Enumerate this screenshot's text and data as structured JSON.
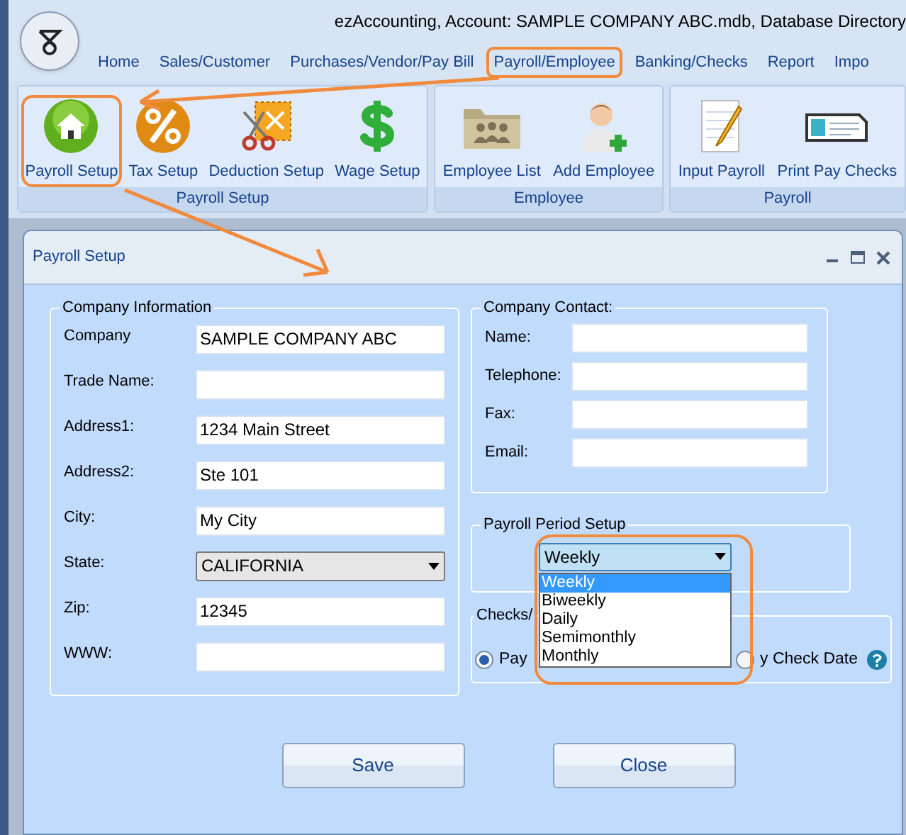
{
  "window": {
    "title": "ezAccounting, Account: SAMPLE COMPANY ABC.mdb, Database Directory"
  },
  "tabs": [
    {
      "label": "Home",
      "highlighted": false
    },
    {
      "label": "Sales/Customer",
      "highlighted": false
    },
    {
      "label": "Purchases/Vendor/Pay Bill",
      "highlighted": false
    },
    {
      "label": "Payroll/Employee",
      "highlighted": true
    },
    {
      "label": "Banking/Checks",
      "highlighted": false
    },
    {
      "label": "Report",
      "highlighted": false
    },
    {
      "label": "Impo",
      "highlighted": false
    }
  ],
  "ribbon": {
    "groups": [
      {
        "label": "Payroll Setup",
        "buttons": [
          {
            "label": "Payroll Setup",
            "highlighted": true
          },
          {
            "label": "Tax Setup",
            "highlighted": false
          },
          {
            "label": "Deduction Setup",
            "highlighted": false
          },
          {
            "label": "Wage Setup",
            "highlighted": false
          }
        ]
      },
      {
        "label": "Employee",
        "buttons": [
          {
            "label": "Employee List",
            "highlighted": false
          },
          {
            "label": "Add Employee",
            "highlighted": false
          }
        ]
      },
      {
        "label": "Payroll",
        "buttons": [
          {
            "label": "Input Payroll",
            "highlighted": false
          },
          {
            "label": "Print Pay Checks",
            "highlighted": false
          }
        ]
      }
    ]
  },
  "dialog": {
    "title": "Payroll Setup",
    "company_information": {
      "title": "Company Information",
      "fields": [
        {
          "kind": "text",
          "label": "Company",
          "value": "SAMPLE COMPANY ABC"
        },
        {
          "kind": "text",
          "label": "Trade Name:"
        },
        {
          "kind": "text",
          "label": "Address1:",
          "value": "1234 Main Street"
        },
        {
          "kind": "text",
          "label": "Address2:",
          "value": "Ste 101"
        },
        {
          "kind": "text",
          "label": "City:",
          "value": "My City"
        },
        {
          "kind": "select",
          "label": "State:",
          "value": "CALIFORNIA"
        },
        {
          "kind": "text",
          "label": "Zip:",
          "value": "12345"
        },
        {
          "kind": "text",
          "label": "WWW:"
        }
      ]
    },
    "company_contact": {
      "title": "Company Contact:",
      "fields": [
        {
          "label": "Name:"
        },
        {
          "label": "Telephone:"
        },
        {
          "label": "Fax:"
        },
        {
          "label": "Email:"
        }
      ]
    },
    "payroll_period": {
      "title": "Payroll Period Setup",
      "value": "Weekly",
      "highlighted": true,
      "options": [
        {
          "label": "Weekly",
          "selected": true
        },
        {
          "label": "Biweekly",
          "selected": false
        },
        {
          "label": "Daily",
          "selected": false
        },
        {
          "label": "Semimonthly",
          "selected": false
        },
        {
          "label": "Monthly",
          "selected": false
        }
      ]
    },
    "checks": {
      "title": "Checks/",
      "options": [
        {
          "label": "Pay",
          "selected": true
        },
        {
          "label": "y Check Date",
          "selected": false
        }
      ]
    },
    "buttons": [
      "Save",
      "Close"
    ]
  }
}
